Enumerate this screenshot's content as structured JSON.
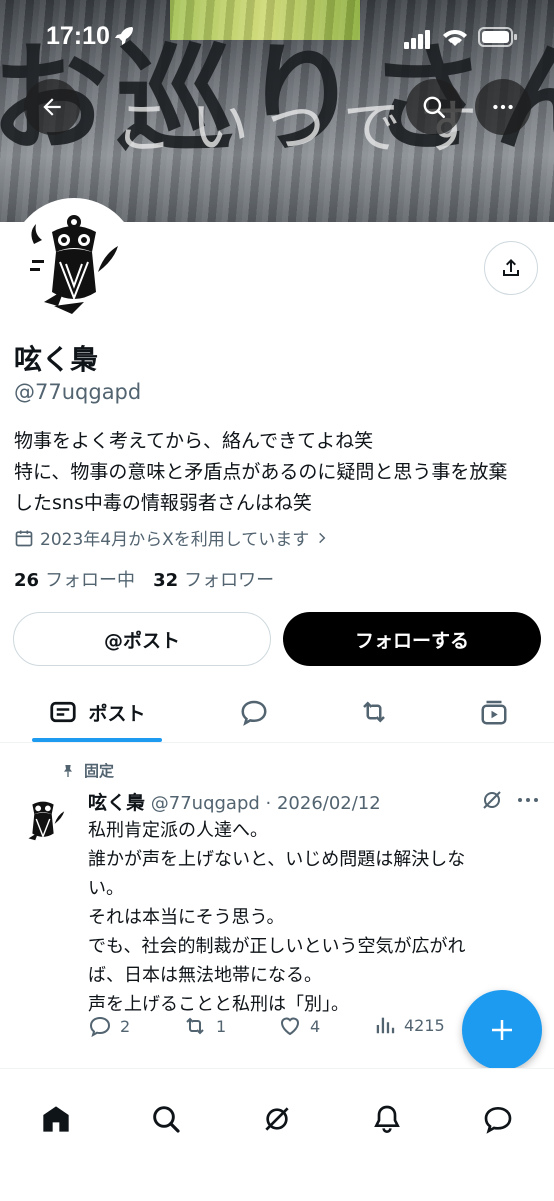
{
  "status": {
    "time": "17:10"
  },
  "banner": {
    "text_large": "お巡りさん",
    "text_small": "こいつです"
  },
  "profile": {
    "name": "呟く梟",
    "handle": "@77uqgapd",
    "bio": [
      "物事をよく考えてから、絡んできてよね笑",
      "特に、物事の意味と矛盾点があるのに疑問と思う事を放棄",
      "したsns中毒の情報弱者さんはね笑"
    ],
    "joined": "2023年4月からXを利用しています",
    "following_count": "26",
    "following_label": "フォロー中",
    "followers_count": "32",
    "followers_label": "フォロワー"
  },
  "buttons": {
    "mention": "@ポスト",
    "follow": "フォローする"
  },
  "tabs": [
    {
      "label": "ポスト"
    }
  ],
  "tweet": {
    "pinned_label": "固定",
    "name": "呟く梟",
    "handle_date": "@77uqgapd · 2026/02/12",
    "lines": [
      "私刑肯定派の人達へ。",
      "誰かが声を上げないと、いじめ問題は解決しな",
      "い。",
      "それは本当にそう思う。",
      "でも、社会的制裁が正しいという空気が広がれ",
      "ば、日本は無法地帯になる。",
      "声を上げることと私刑は「別」。"
    ],
    "replies": "2",
    "reposts": "1",
    "likes": "4",
    "views": "4215"
  },
  "colors": {
    "accent": "#1d9bf0",
    "text": "#0f1419",
    "muted": "#536471"
  }
}
